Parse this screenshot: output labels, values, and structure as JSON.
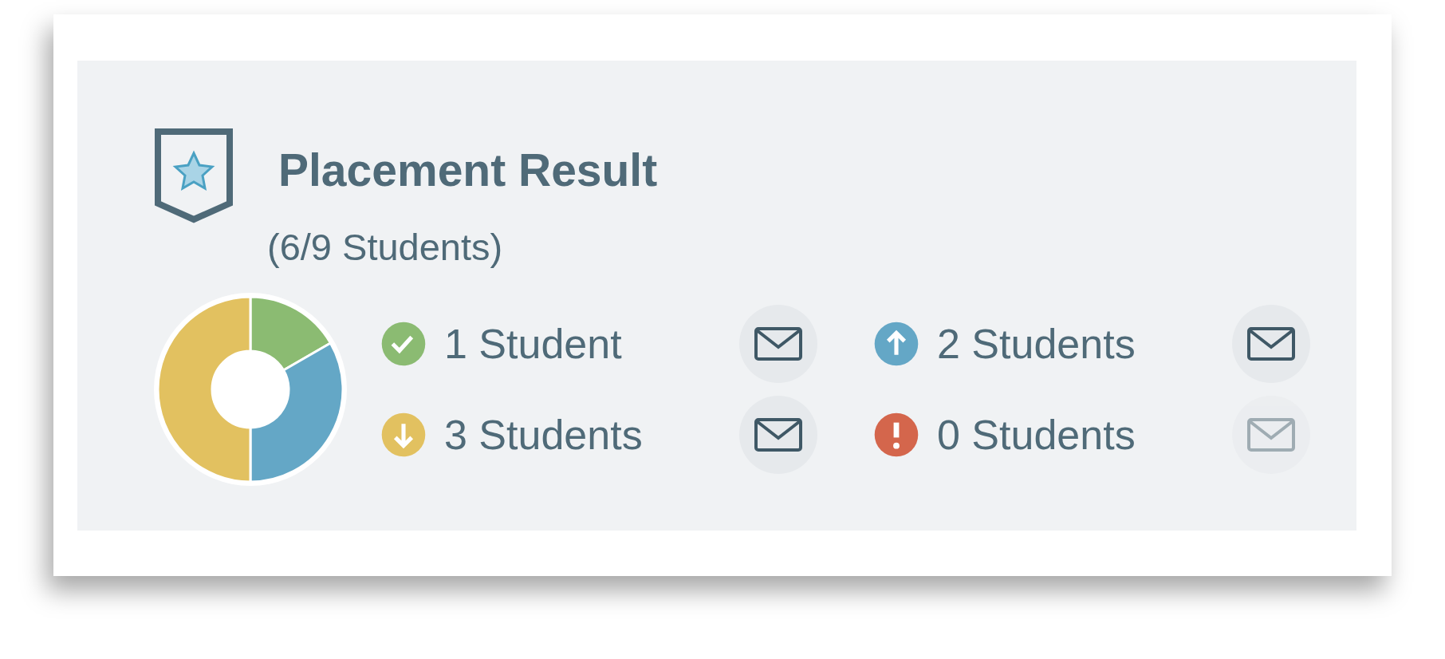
{
  "card": {
    "title": "Placement Result",
    "subtitle": "(6/9 Students)"
  },
  "chart_data": {
    "type": "donut",
    "values": [
      16.67,
      33.33,
      50,
      0
    ],
    "colors": [
      "#8bbb72",
      "#64a7c6",
      "#e2c160",
      "#d4664c"
    ]
  },
  "groups": [
    {
      "kind": "check",
      "label": "1 Student",
      "color": "#8bbb72",
      "disabled": false
    },
    {
      "kind": "up",
      "label": "2 Students",
      "color": "#64a7c6",
      "disabled": false
    },
    {
      "kind": "down",
      "label": "3 Students",
      "color": "#e2c160",
      "disabled": false
    },
    {
      "kind": "alert",
      "label": "0 Students",
      "color": "#d4664c",
      "disabled": true
    }
  ]
}
